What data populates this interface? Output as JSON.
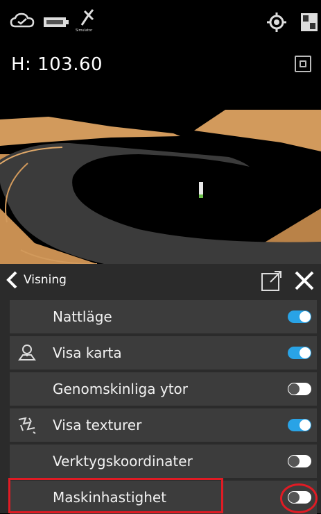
{
  "viewport": {
    "height_readout": "H: 103.60",
    "simulator_label": "Simulator"
  },
  "status_icons": [
    "cloud-check-icon",
    "battery-icon",
    "satellite-icon",
    "location-target-icon",
    "layout-panel-icon"
  ],
  "panel": {
    "title": "Visning",
    "items": [
      {
        "label": "Nattläge",
        "icon": null,
        "enabled": true
      },
      {
        "label": "Visa karta",
        "icon": "map-pin-icon",
        "enabled": true
      },
      {
        "label": "Genomskinliga ytor",
        "icon": null,
        "enabled": false
      },
      {
        "label": "Visa texturer",
        "icon": "texture-icon",
        "enabled": true
      },
      {
        "label": "Verktygskoordinater",
        "icon": null,
        "enabled": false
      },
      {
        "label": "Maskinhastighet",
        "icon": null,
        "enabled": false
      }
    ]
  },
  "colors": {
    "accent": "#29a3e6",
    "terrain": "#d29a5c",
    "highlight": "#e01b24"
  }
}
